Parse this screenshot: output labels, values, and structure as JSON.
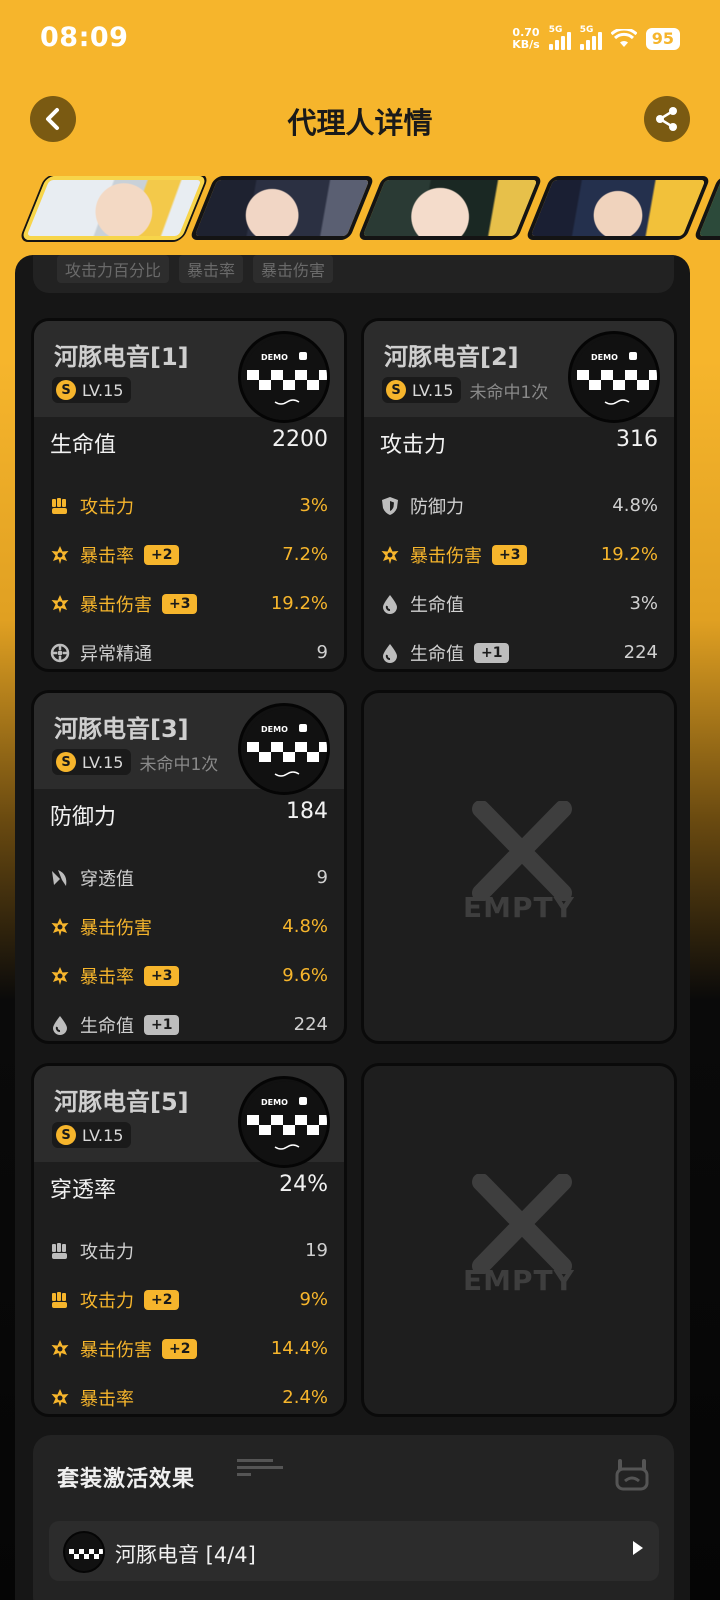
{
  "status_bar": {
    "time": "08:09",
    "net_speed_value": "0.70",
    "net_speed_unit": "KB/s",
    "sim1": "5G",
    "sim2": "5G",
    "battery": "95"
  },
  "header": {
    "title": "代理人详情",
    "back_icon": "chevron-left-icon",
    "share_icon": "share-icon"
  },
  "previous_card_tags": [
    "攻击力百分比",
    "暴击率",
    "暴击伤害"
  ],
  "discs": [
    {
      "name": "河豚电音[1]",
      "rank": "S",
      "level": "LV.15",
      "miss": "",
      "main": {
        "label": "生命值",
        "value": "2200"
      },
      "subs": [
        {
          "icon": "fist-icon",
          "label": "攻击力",
          "boost": "",
          "value": "3%",
          "highlight": true
        },
        {
          "icon": "crit-icon",
          "label": "暴击率",
          "boost": "+2",
          "value": "7.2%",
          "highlight": true
        },
        {
          "icon": "crit-icon",
          "label": "暴击伤害",
          "boost": "+3",
          "value": "19.2%",
          "highlight": true
        },
        {
          "icon": "anomaly-icon",
          "label": "异常精通",
          "boost": "",
          "value": "9",
          "highlight": false
        }
      ]
    },
    {
      "name": "河豚电音[2]",
      "rank": "S",
      "level": "LV.15",
      "miss": "未命中1次",
      "main": {
        "label": "攻击力",
        "value": "316"
      },
      "subs": [
        {
          "icon": "shield-icon",
          "label": "防御力",
          "boost": "",
          "value": "4.8%",
          "highlight": false
        },
        {
          "icon": "crit-icon",
          "label": "暴击伤害",
          "boost": "+3",
          "value": "19.2%",
          "highlight": true
        },
        {
          "icon": "drop-icon",
          "label": "生命值",
          "boost": "",
          "value": "3%",
          "highlight": false
        },
        {
          "icon": "drop-icon",
          "label": "生命值",
          "boost": "+1",
          "value": "224",
          "highlight": false
        }
      ]
    },
    {
      "name": "河豚电音[3]",
      "rank": "S",
      "level": "LV.15",
      "miss": "未命中1次",
      "main": {
        "label": "防御力",
        "value": "184"
      },
      "subs": [
        {
          "icon": "pierce-icon",
          "label": "穿透值",
          "boost": "",
          "value": "9",
          "highlight": false
        },
        {
          "icon": "crit-icon",
          "label": "暴击伤害",
          "boost": "",
          "value": "4.8%",
          "highlight": true
        },
        {
          "icon": "crit-icon",
          "label": "暴击率",
          "boost": "+3",
          "value": "9.6%",
          "highlight": true
        },
        {
          "icon": "drop-icon",
          "label": "生命值",
          "boost": "+1",
          "value": "224",
          "highlight": false
        }
      ]
    },
    {
      "name": "河豚电音[5]",
      "rank": "S",
      "level": "LV.15",
      "miss": "",
      "main": {
        "label": "穿透率",
        "value": "24%"
      },
      "subs": [
        {
          "icon": "fist-icon",
          "label": "攻击力",
          "boost": "",
          "value": "19",
          "highlight": false
        },
        {
          "icon": "fist-icon",
          "label": "攻击力",
          "boost": "+2",
          "value": "9%",
          "highlight": true
        },
        {
          "icon": "crit-icon",
          "label": "暴击伤害",
          "boost": "+2",
          "value": "14.4%",
          "highlight": true
        },
        {
          "icon": "crit-icon",
          "label": "暴击率",
          "boost": "",
          "value": "2.4%",
          "highlight": true
        }
      ]
    }
  ],
  "empty_slot_label": "EMPTY",
  "set_effects": {
    "title": "套装激活效果",
    "items": [
      {
        "name": "河豚电音 [4/4]"
      }
    ]
  },
  "colors": {
    "accent": "#f6b52c",
    "panel": "#161616",
    "card": "#1e1e1e"
  }
}
